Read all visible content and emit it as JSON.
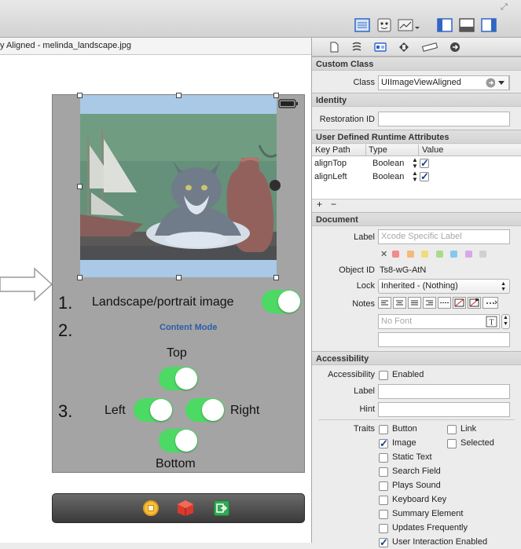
{
  "toolbar": {
    "corner_glyph": "⤢",
    "buttons": [
      "standard-editor",
      "assistant-editor",
      "version-editor",
      "toggle-navigator",
      "toggle-debug-area",
      "toggle-utilities"
    ]
  },
  "file_bar": {
    "title": "y Aligned - melinda_landscape.jpg"
  },
  "scene": {
    "row1_num": "1.",
    "row1_label": "Landscape/portrait image",
    "row2_num": "2.",
    "row2_label": "Content Mode",
    "row3_num": "3.",
    "top_label": "Top",
    "left_label": "Left",
    "right_label": "Right",
    "bottom_label": "Bottom",
    "switches": {
      "landscape": true,
      "top": true,
      "left": true,
      "right": true,
      "bottom": true
    },
    "accent": "#4cd964",
    "content_mode_color": "#2b5ea7"
  },
  "inspector": {
    "custom_class": {
      "header": "Custom Class",
      "class_label": "Class",
      "class_value": "UIImageViewAligned"
    },
    "identity": {
      "header": "Identity",
      "restoration_label": "Restoration ID",
      "restoration_value": ""
    },
    "runtime": {
      "header": "User Defined Runtime Attributes",
      "columns": [
        "Key Path",
        "Type",
        "Value"
      ],
      "rows": [
        {
          "key": "alignTop",
          "type": "Boolean",
          "value": true
        },
        {
          "key": "alignLeft",
          "type": "Boolean",
          "value": true
        }
      ],
      "add": "+",
      "remove": "−"
    },
    "document": {
      "header": "Document",
      "label_label": "Label",
      "label_placeholder": "Xcode Specific Label",
      "clear_glyph": "✕",
      "object_id_label": "Object ID",
      "object_id_value": "Ts8-wG-AtN",
      "lock_label": "Lock",
      "lock_value": "Inherited - (Nothing)",
      "notes_label": "Notes",
      "font_placeholder": "No Font",
      "colors": [
        "#f28b8b",
        "#f5b97a",
        "#f0dc7a",
        "#a8dc8c",
        "#86c8f0",
        "#d8a8e8",
        "#d0d0d0"
      ]
    },
    "accessibility": {
      "header": "Accessibility",
      "accessibility_label": "Accessibility",
      "enabled_label": "Enabled",
      "enabled": false,
      "label_label": "Label",
      "hint_label": "Hint",
      "traits_label": "Traits",
      "traits": [
        {
          "name": "Button",
          "checked": false
        },
        {
          "name": "Link",
          "checked": false
        },
        {
          "name": "Image",
          "checked": true
        },
        {
          "name": "Selected",
          "checked": false
        },
        {
          "name": "Static Text",
          "checked": false
        },
        {
          "name": "Search Field",
          "checked": false
        },
        {
          "name": "Plays Sound",
          "checked": false
        },
        {
          "name": "Keyboard Key",
          "checked": false
        },
        {
          "name": "Summary Element",
          "checked": false
        },
        {
          "name": "Updates Frequently",
          "checked": false
        },
        {
          "name": "User Interaction Enabled",
          "checked": true
        }
      ]
    }
  }
}
